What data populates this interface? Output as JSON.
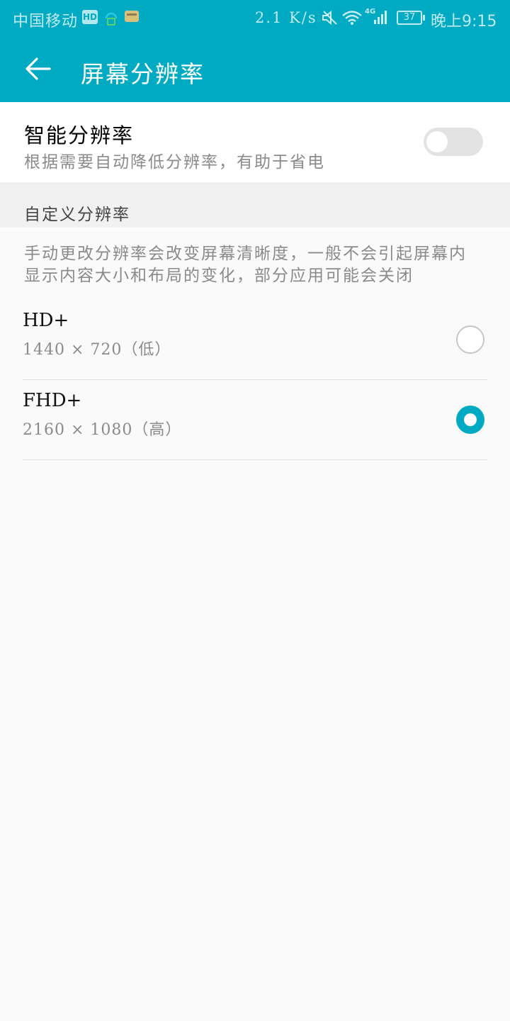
{
  "status_bar": {
    "carrier": "中国移动",
    "hd_badge": "HD",
    "net_speed": "2.1 K/s",
    "network_badge": "4G",
    "battery": "37",
    "time": "晚上9:15"
  },
  "app_bar": {
    "title": "屏幕分辨率",
    "background_color": "#00aac2"
  },
  "smart_resolution": {
    "title": "智能分辨率",
    "subtitle": "根据需要自动降低分辨率，有助于省电",
    "enabled": false
  },
  "custom_section": {
    "header": "自定义分辨率",
    "description": "手动更改分辨率会改变屏幕清晰度，一般不会引起屏幕内显示内容大小和布局的变化，部分应用可能会关闭"
  },
  "options": [
    {
      "name": "HD+",
      "detail": "1440 × 720（低）",
      "selected": false
    },
    {
      "name": "FHD+",
      "detail": "2160 × 1080（高）",
      "selected": true
    }
  ],
  "icons": [
    "back-arrow-icon",
    "mute-icon",
    "wifi-icon",
    "signal-icon",
    "battery-icon"
  ]
}
